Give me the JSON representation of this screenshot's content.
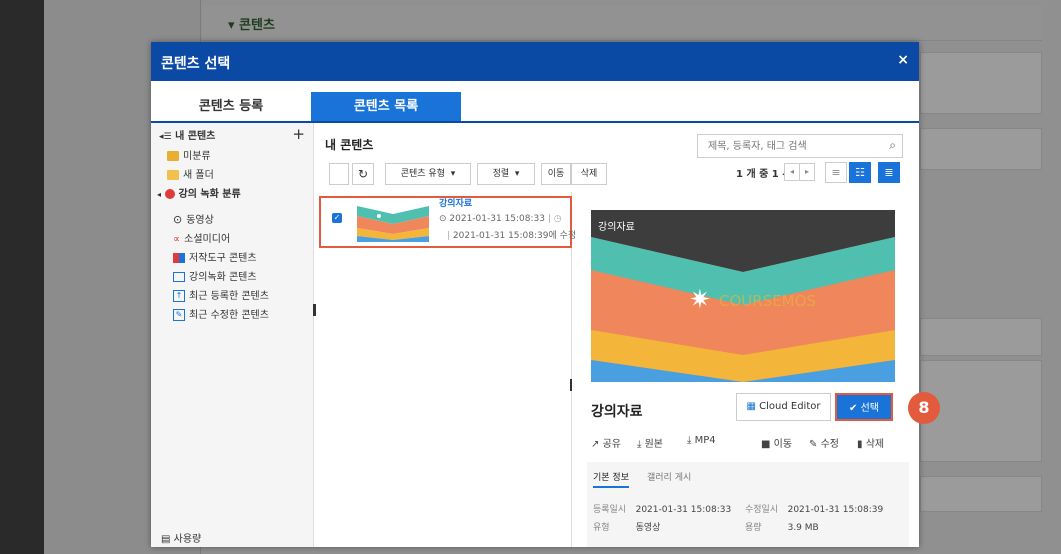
{
  "background": {
    "section_title": "▾ 콘텐츠"
  },
  "modal": {
    "title": "콘텐츠 선택",
    "close_label": "×"
  },
  "tabs": [
    {
      "label": "콘텐츠 등록"
    },
    {
      "label": "콘텐츠 목록"
    }
  ],
  "sidebar": {
    "root_label": "내 콘텐츠",
    "add_label": "+",
    "items": [
      {
        "label": "미분류"
      },
      {
        "label": "새 폴더"
      },
      {
        "label": "강의 녹화 분류"
      },
      {
        "label": "동영상"
      },
      {
        "label": "소셜미디어"
      },
      {
        "label": "저작도구 콘텐츠"
      },
      {
        "label": "강의녹화 콘텐츠"
      },
      {
        "label": "최근 등록한 콘텐츠"
      },
      {
        "label": "최근 수정한 콘텐츠"
      }
    ],
    "usage_label": "사용량"
  },
  "content": {
    "title": "내 콘텐츠",
    "search_placeholder": "제목, 등록자, 태그 검색",
    "toolbar": {
      "type_label": "콘텐츠 유형",
      "sort_label": "정렬",
      "move_label": "이동",
      "delete_label": "삭제"
    },
    "pager_text": "1 개 중 1 - 1"
  },
  "list_item": {
    "title": "강의자료",
    "created": "2021-01-31 15:08:33",
    "modified": "2021-01-31 15:08:39에 수정"
  },
  "detail": {
    "preview_label": "강의자료",
    "watermark": "COURSEMOS",
    "title": "강의자료",
    "cloud_editor_label": "Cloud Editor",
    "select_label": "선택",
    "step_number": "8",
    "actions": {
      "share": "공유",
      "original": "원본",
      "mp4": "MP4",
      "move": "이동",
      "edit": "수정",
      "delete": "삭제"
    },
    "info_tabs": [
      "기본 정보",
      "갤러리 게시"
    ],
    "info": {
      "reg_key": "등록일시",
      "reg_value": "2021-01-31 15:08:33",
      "mod_key": "수정일시",
      "mod_value": "2021-01-31 15:08:39",
      "type_key": "유형",
      "type_value": "동영상",
      "size_key": "용량",
      "size_value": "3.9 MB"
    }
  },
  "colors": {
    "primary": "#0a4aa5",
    "accent": "#1a73d9",
    "highlight": "#e25b3d"
  }
}
